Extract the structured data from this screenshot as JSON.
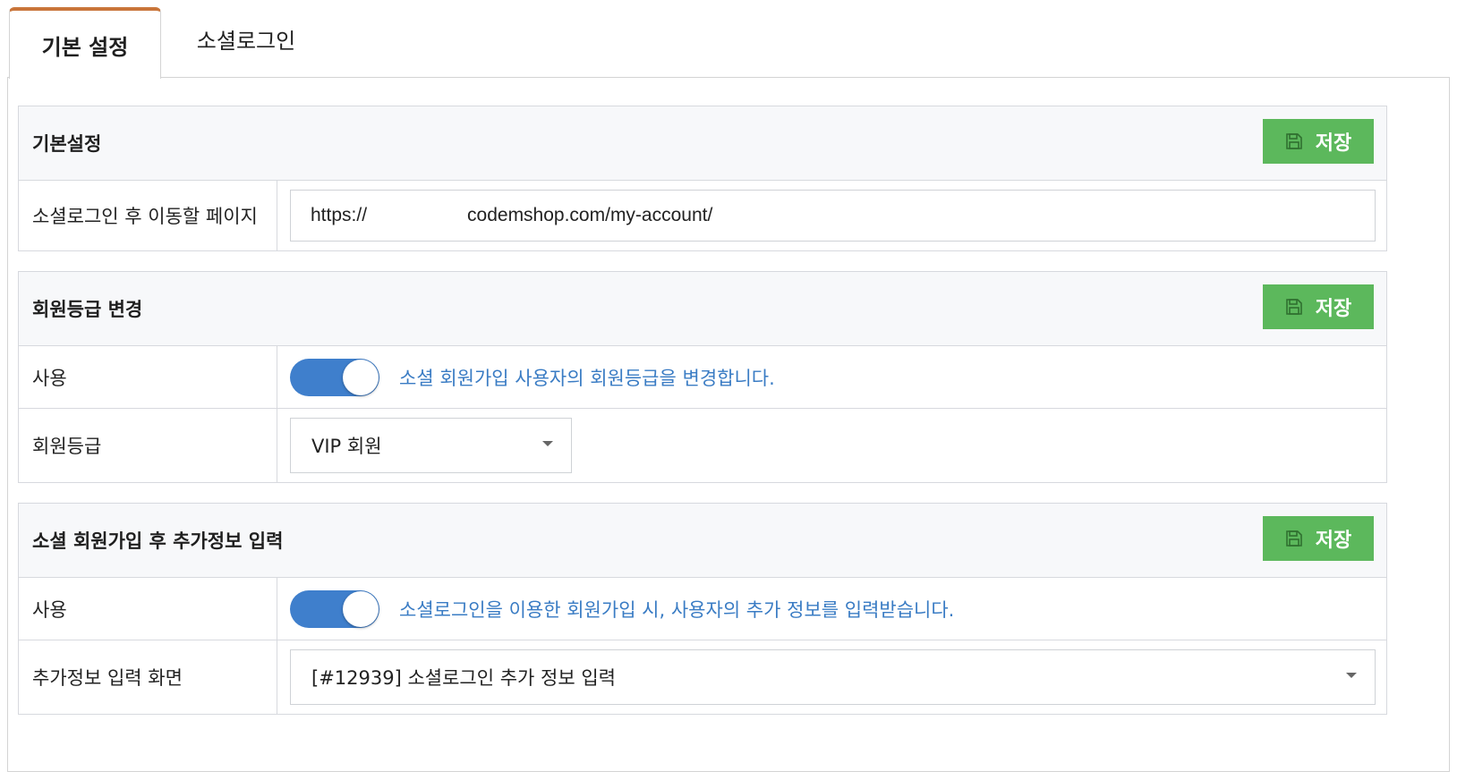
{
  "tabs": [
    {
      "label": "기본 설정",
      "active": true
    },
    {
      "label": "소셜로그인",
      "active": false
    }
  ],
  "colors": {
    "accent_tab": "#c9753a",
    "save_button": "#5cb85c",
    "toggle_on": "#3f7fcc",
    "help_text": "#3a7cc4"
  },
  "sections": [
    {
      "title": "기본설정",
      "save_label": "저장",
      "redirect": {
        "label": "소셜로그인 후 이동할 페이지",
        "value_prefix": "https://",
        "value_suffix": "codemshop.com/my-account/"
      }
    },
    {
      "title": "회원등급 변경",
      "save_label": "저장",
      "use": {
        "label": "사용",
        "enabled": true,
        "help": "소셜 회원가입 사용자의 회원등급을 변경합니다."
      },
      "grade": {
        "label": "회원등급",
        "selected": "VIP 회원"
      }
    },
    {
      "title": "소셜 회원가입 후 추가정보 입력",
      "save_label": "저장",
      "use": {
        "label": "사용",
        "enabled": true,
        "help": "소셜로그인을 이용한 회원가입 시, 사용자의 추가 정보를 입력받습니다."
      },
      "screen": {
        "label": "추가정보 입력 화면",
        "selected": "[#12939] 소셜로그인 추가 정보 입력"
      }
    }
  ],
  "icons": {
    "save": "floppy-disk-icon",
    "dropdown": "caret-down-icon"
  }
}
